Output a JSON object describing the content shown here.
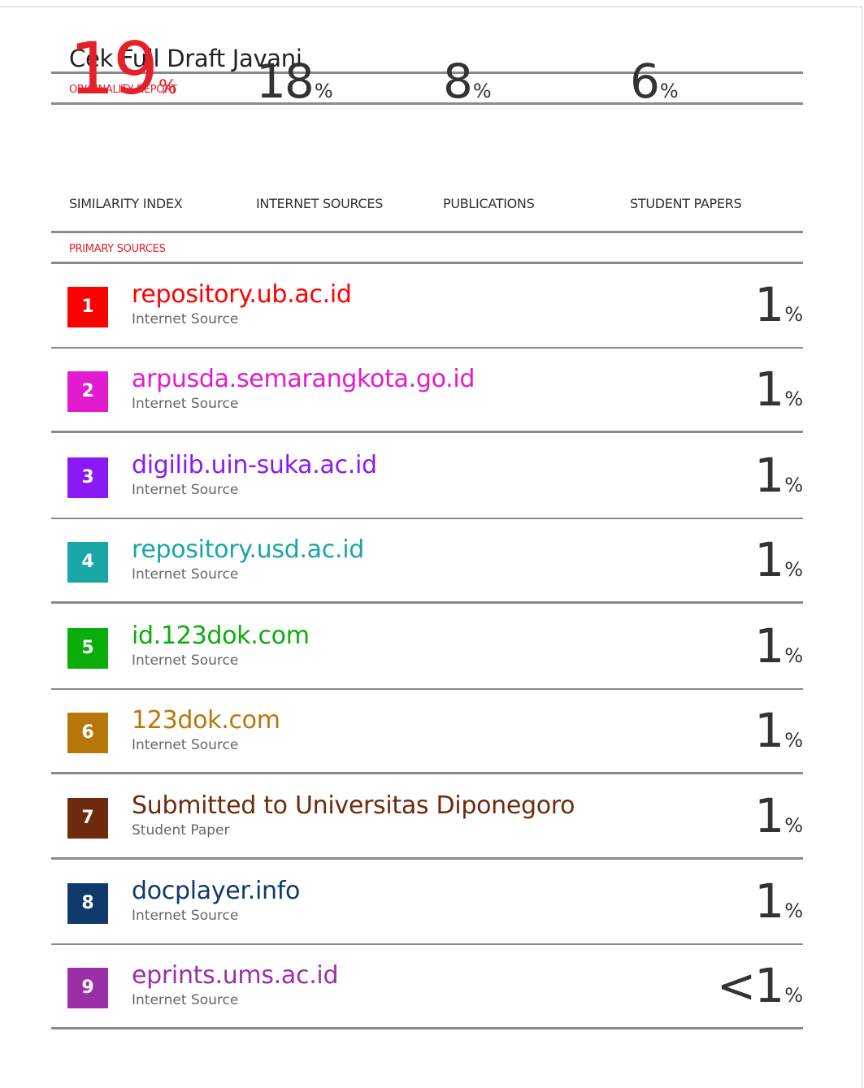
{
  "report": {
    "title": "Cek Full Draft Javani",
    "originality_label": "ORIGINALITY REPORT",
    "primary_sources_label": "PRIMARY SOURCES",
    "accent_color": "#e4202b"
  },
  "stats": [
    {
      "value": "19",
      "pct": "%",
      "label": "SIMILARITY INDEX"
    },
    {
      "value": "18",
      "pct": "%",
      "label": "INTERNET SOURCES"
    },
    {
      "value": "8",
      "pct": "%",
      "label": "PUBLICATIONS"
    },
    {
      "value": "6",
      "pct": "%",
      "label": "STUDENT PAPERS"
    }
  ],
  "sources": [
    {
      "rank": "1",
      "name": "repository.ub.ac.id",
      "type": "Internet Source",
      "percent": "1",
      "pct": "%",
      "color": "#ff0000"
    },
    {
      "rank": "2",
      "name": "arpusda.semarangkota.go.id",
      "type": "Internet Source",
      "percent": "1",
      "pct": "%",
      "color": "#e31ad0"
    },
    {
      "rank": "3",
      "name": "digilib.uin-suka.ac.id",
      "type": "Internet Source",
      "percent": "1",
      "pct": "%",
      "color": "#8a19f5"
    },
    {
      "rank": "4",
      "name": "repository.usd.ac.id",
      "type": "Internet Source",
      "percent": "1",
      "pct": "%",
      "color": "#1aa6a6"
    },
    {
      "rank": "5",
      "name": "id.123dok.com",
      "type": "Internet Source",
      "percent": "1",
      "pct": "%",
      "color": "#0aad0a"
    },
    {
      "rank": "6",
      "name": "123dok.com",
      "type": "Internet Source",
      "percent": "1",
      "pct": "%",
      "color": "#b8770b"
    },
    {
      "rank": "7",
      "name": "Submitted to Universitas Diponegoro",
      "type": "Student Paper",
      "percent": "1",
      "pct": "%",
      "color": "#6e2a0c"
    },
    {
      "rank": "8",
      "name": "docplayer.info",
      "type": "Internet Source",
      "percent": "1",
      "pct": "%",
      "color": "#0f3a6b"
    },
    {
      "rank": "9",
      "name": "eprints.ums.ac.id",
      "type": "Internet Source",
      "percent": "<1",
      "pct": "%",
      "color": "#9b2fa8"
    }
  ]
}
